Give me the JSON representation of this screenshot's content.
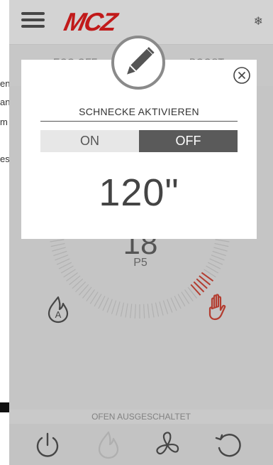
{
  "left_fragments": [
    "en",
    "an",
    "m",
    "es"
  ],
  "header": {
    "logo": "MCZ",
    "snowflake": "❄"
  },
  "subbar": {
    "eco_label": "ECO OFF",
    "boost_label": "BOOST"
  },
  "gauge": {
    "temperature": "18",
    "power_level": "P5"
  },
  "status": {
    "text": "OFEN AUSGESCHALTET"
  },
  "modal": {
    "title": "SCHNECKE AKTIVIEREN",
    "on_label": "ON",
    "off_label": "OFF",
    "selected": "OFF",
    "value": "120\""
  },
  "icons": {
    "menu": "hamburger-menu-icon",
    "snow": "snowflake-icon",
    "edit": "pencil-icon",
    "close": "close-icon",
    "auto": "flame-auto-icon",
    "manual": "hand-icon",
    "power": "power-icon",
    "flame": "flame-icon",
    "fan": "fan-icon",
    "reset": "reset-icon"
  },
  "colors": {
    "brand": "#d01212",
    "accent": "#c0392b"
  }
}
